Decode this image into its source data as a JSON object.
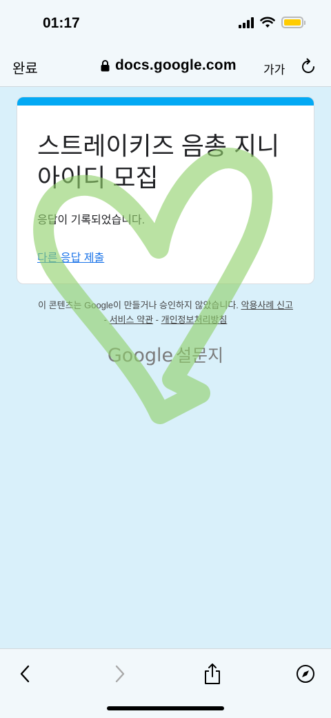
{
  "status_bar": {
    "time": "01:17",
    "icons": [
      "cellular-signal-icon",
      "wifi-icon",
      "battery-icon"
    ],
    "battery_color": "#ffcc00"
  },
  "browser": {
    "done_label": "완료",
    "url": "docs.google.com",
    "text_size_label": "가가",
    "icons": [
      "lock-icon",
      "reload-icon"
    ]
  },
  "form": {
    "accent_color": "#03a9f4",
    "title": "스트레이키즈 음총 지니 아이디 모집",
    "confirmation": "응답이 기록되었습니다.",
    "submit_another_link": "다른 응답 제출"
  },
  "footer": {
    "disclaimer": "이 콘텐츠는 Google이 만들거나 승인하지 않았습니다.",
    "report_abuse": "악용사례 신고",
    "separator": "-",
    "terms": "서비스 약관",
    "privacy": "개인정보처리방침",
    "brand_google": "Google",
    "brand_forms": "설문지"
  },
  "decoration": {
    "sticker": "green-heart-doodle",
    "sticker_color": "#8fd16a"
  },
  "toolbar": {
    "icons": [
      "back-icon",
      "forward-icon",
      "share-icon",
      "compass-icon"
    ]
  }
}
